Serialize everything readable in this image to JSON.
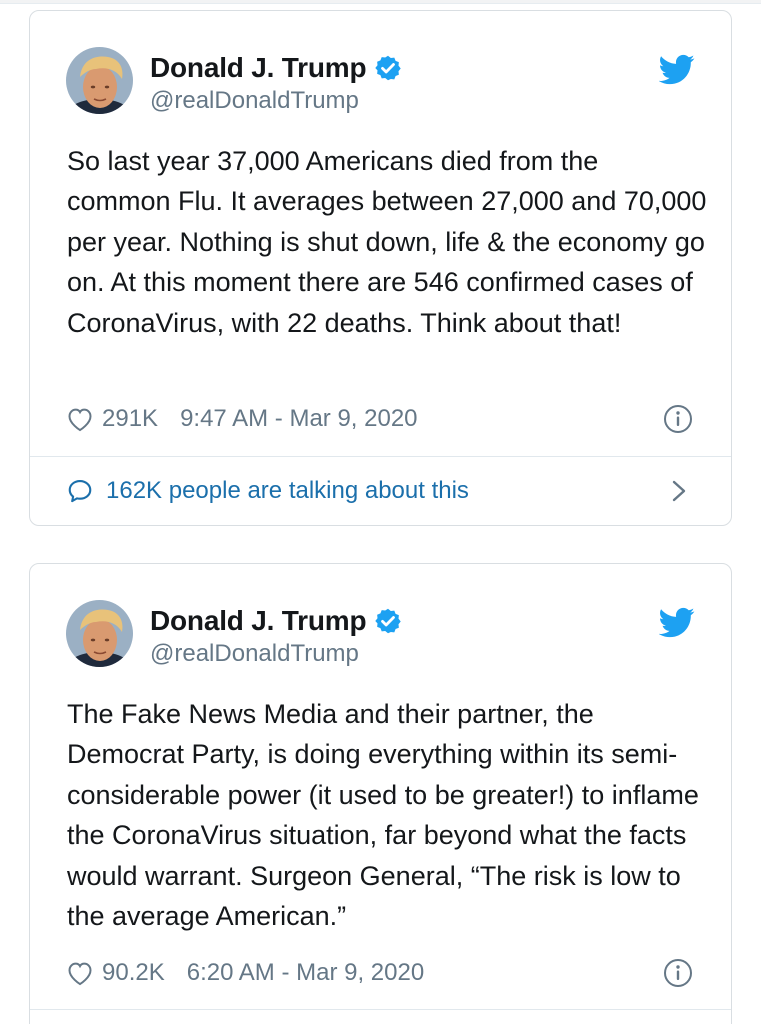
{
  "colors": {
    "text": "#14171a",
    "secondary": "#657786",
    "link": "#1b6fab",
    "twitter_blue": "#1da1f2",
    "border": "#d9dee2"
  },
  "icons": {
    "avatar": "profile-photo",
    "verified": "verified-badge-icon",
    "brand": "twitter-bird-icon",
    "like": "heart-icon",
    "info": "info-icon",
    "talk": "speech-bubble-icon",
    "more": "chevron-right-icon"
  },
  "tweets": [
    {
      "display_name": "Donald J. Trump",
      "handle": "@realDonaldTrump",
      "text": "So last year 37,000 Americans died from the common Flu. It averages between 27,000 and 70,000 per year. Nothing is shut down, life & the economy go on. At this moment there are 546 confirmed cases of CoronaVirus, with 22 deaths. Think about that!",
      "likes": "291K",
      "timestamp": "9:47 AM - Mar 9, 2020",
      "talking": "162K people are talking about this"
    },
    {
      "display_name": "Donald J. Trump",
      "handle": "@realDonaldTrump",
      "text": "The Fake News Media and their partner, the Democrat Party, is doing everything within its semi-considerable power (it used to be greater!) to inflame the CoronaVirus situation, far beyond what the facts would warrant. Surgeon General, “The risk is low to the average American.”",
      "likes": "90.2K",
      "timestamp": "6:20 AM - Mar 9, 2020"
    }
  ]
}
